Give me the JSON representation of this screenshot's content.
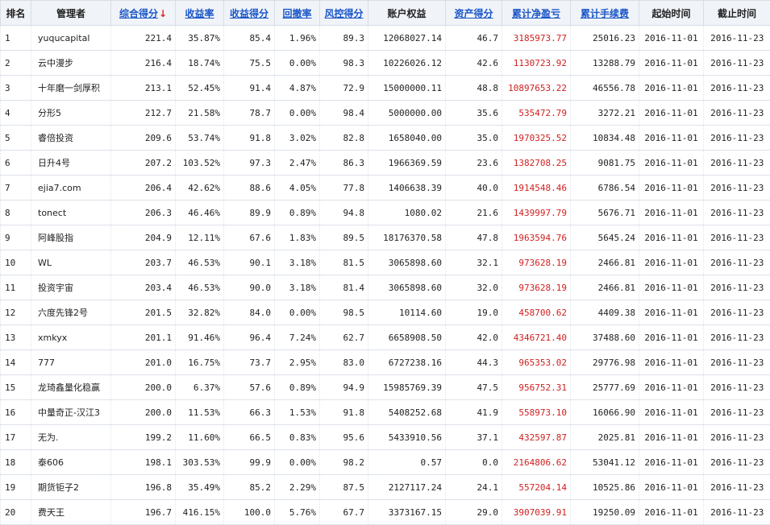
{
  "colors": {
    "link": "#1a56c8",
    "profit": "#d02020",
    "header_bg": "#f0f3f8",
    "sort_arrow": "#e02020"
  },
  "header": {
    "rank": "排名",
    "manager": "管理者",
    "score": "综合得分",
    "sort_arrow": "↓",
    "return_rate": "收益率",
    "return_score": "收益得分",
    "drawdown": "回撤率",
    "risk_score": "风控得分",
    "equity": "账户权益",
    "asset_score": "资产得分",
    "net_profit": "累计净盈亏",
    "fees": "累计手续费",
    "start": "起始时间",
    "end": "截止时间"
  },
  "rows": [
    {
      "rank": "1",
      "manager": "yuqucapital",
      "score": "221.4",
      "return_rate": "35.87%",
      "return_score": "85.4",
      "drawdown": "1.96%",
      "risk_score": "89.3",
      "equity": "12068027.14",
      "asset_score": "46.7",
      "net_profit": "3185973.77",
      "fees": "25016.23",
      "start": "2016-11-01",
      "end": "2016-11-23"
    },
    {
      "rank": "2",
      "manager": "云中漫步",
      "score": "216.4",
      "return_rate": "18.74%",
      "return_score": "75.5",
      "drawdown": "0.00%",
      "risk_score": "98.3",
      "equity": "10226026.12",
      "asset_score": "42.6",
      "net_profit": "1130723.92",
      "fees": "13288.79",
      "start": "2016-11-01",
      "end": "2016-11-23"
    },
    {
      "rank": "3",
      "manager": "十年磨一剑厚积",
      "score": "213.1",
      "return_rate": "52.45%",
      "return_score": "91.4",
      "drawdown": "4.87%",
      "risk_score": "72.9",
      "equity": "15000000.11",
      "asset_score": "48.8",
      "net_profit": "10897653.22",
      "fees": "46556.78",
      "start": "2016-11-01",
      "end": "2016-11-23"
    },
    {
      "rank": "4",
      "manager": "分形5",
      "score": "212.7",
      "return_rate": "21.58%",
      "return_score": "78.7",
      "drawdown": "0.00%",
      "risk_score": "98.4",
      "equity": "5000000.00",
      "asset_score": "35.6",
      "net_profit": "535472.79",
      "fees": "3272.21",
      "start": "2016-11-01",
      "end": "2016-11-23"
    },
    {
      "rank": "5",
      "manager": "睿倍投资",
      "score": "209.6",
      "return_rate": "53.74%",
      "return_score": "91.8",
      "drawdown": "3.02%",
      "risk_score": "82.8",
      "equity": "1658040.00",
      "asset_score": "35.0",
      "net_profit": "1970325.52",
      "fees": "10834.48",
      "start": "2016-11-01",
      "end": "2016-11-23"
    },
    {
      "rank": "6",
      "manager": "日升4号",
      "score": "207.2",
      "return_rate": "103.52%",
      "return_score": "97.3",
      "drawdown": "2.47%",
      "risk_score": "86.3",
      "equity": "1966369.59",
      "asset_score": "23.6",
      "net_profit": "1382708.25",
      "fees": "9081.75",
      "start": "2016-11-01",
      "end": "2016-11-23"
    },
    {
      "rank": "7",
      "manager": "ejia7.com",
      "score": "206.4",
      "return_rate": "42.62%",
      "return_score": "88.6",
      "drawdown": "4.05%",
      "risk_score": "77.8",
      "equity": "1406638.39",
      "asset_score": "40.0",
      "net_profit": "1914548.46",
      "fees": "6786.54",
      "start": "2016-11-01",
      "end": "2016-11-23"
    },
    {
      "rank": "8",
      "manager": "tonect",
      "score": "206.3",
      "return_rate": "46.46%",
      "return_score": "89.9",
      "drawdown": "0.89%",
      "risk_score": "94.8",
      "equity": "1080.02",
      "asset_score": "21.6",
      "net_profit": "1439997.79",
      "fees": "5676.71",
      "start": "2016-11-01",
      "end": "2016-11-23"
    },
    {
      "rank": "9",
      "manager": "阿峰股指",
      "score": "204.9",
      "return_rate": "12.11%",
      "return_score": "67.6",
      "drawdown": "1.83%",
      "risk_score": "89.5",
      "equity": "18176370.58",
      "asset_score": "47.8",
      "net_profit": "1963594.76",
      "fees": "5645.24",
      "start": "2016-11-01",
      "end": "2016-11-23"
    },
    {
      "rank": "10",
      "manager": "WL",
      "score": "203.7",
      "return_rate": "46.53%",
      "return_score": "90.1",
      "drawdown": "3.18%",
      "risk_score": "81.5",
      "equity": "3065898.60",
      "asset_score": "32.1",
      "net_profit": "973628.19",
      "fees": "2466.81",
      "start": "2016-11-01",
      "end": "2016-11-23"
    },
    {
      "rank": "11",
      "manager": "投资宇宙",
      "score": "203.4",
      "return_rate": "46.53%",
      "return_score": "90.0",
      "drawdown": "3.18%",
      "risk_score": "81.4",
      "equity": "3065898.60",
      "asset_score": "32.0",
      "net_profit": "973628.19",
      "fees": "2466.81",
      "start": "2016-11-01",
      "end": "2016-11-23"
    },
    {
      "rank": "12",
      "manager": "六度先锋2号",
      "score": "201.5",
      "return_rate": "32.82%",
      "return_score": "84.0",
      "drawdown": "0.00%",
      "risk_score": "98.5",
      "equity": "10114.60",
      "asset_score": "19.0",
      "net_profit": "458700.62",
      "fees": "4409.38",
      "start": "2016-11-01",
      "end": "2016-11-23"
    },
    {
      "rank": "13",
      "manager": "xmkyx",
      "score": "201.1",
      "return_rate": "91.46%",
      "return_score": "96.4",
      "drawdown": "7.24%",
      "risk_score": "62.7",
      "equity": "6658908.50",
      "asset_score": "42.0",
      "net_profit": "4346721.40",
      "fees": "37488.60",
      "start": "2016-11-01",
      "end": "2016-11-23"
    },
    {
      "rank": "14",
      "manager": "777",
      "score": "201.0",
      "return_rate": "16.75%",
      "return_score": "73.7",
      "drawdown": "2.95%",
      "risk_score": "83.0",
      "equity": "6727238.16",
      "asset_score": "44.3",
      "net_profit": "965353.02",
      "fees": "29776.98",
      "start": "2016-11-01",
      "end": "2016-11-23"
    },
    {
      "rank": "15",
      "manager": "龙琦鑫量化稳赢",
      "score": "200.0",
      "return_rate": "6.37%",
      "return_score": "57.6",
      "drawdown": "0.89%",
      "risk_score": "94.9",
      "equity": "15985769.39",
      "asset_score": "47.5",
      "net_profit": "956752.31",
      "fees": "25777.69",
      "start": "2016-11-01",
      "end": "2016-11-23"
    },
    {
      "rank": "16",
      "manager": "中量奇正-汉江3",
      "score": "200.0",
      "return_rate": "11.53%",
      "return_score": "66.3",
      "drawdown": "1.53%",
      "risk_score": "91.8",
      "equity": "5408252.68",
      "asset_score": "41.9",
      "net_profit": "558973.10",
      "fees": "16066.90",
      "start": "2016-11-01",
      "end": "2016-11-23"
    },
    {
      "rank": "17",
      "manager": "无为.",
      "score": "199.2",
      "return_rate": "11.60%",
      "return_score": "66.5",
      "drawdown": "0.83%",
      "risk_score": "95.6",
      "equity": "5433910.56",
      "asset_score": "37.1",
      "net_profit": "432597.87",
      "fees": "2025.81",
      "start": "2016-11-01",
      "end": "2016-11-23"
    },
    {
      "rank": "18",
      "manager": "泰606",
      "score": "198.1",
      "return_rate": "303.53%",
      "return_score": "99.9",
      "drawdown": "0.00%",
      "risk_score": "98.2",
      "equity": "0.57",
      "asset_score": "0.0",
      "net_profit": "2164806.62",
      "fees": "53041.12",
      "start": "2016-11-01",
      "end": "2016-11-23"
    },
    {
      "rank": "19",
      "manager": "期货钜子2",
      "score": "196.8",
      "return_rate": "35.49%",
      "return_score": "85.2",
      "drawdown": "2.29%",
      "risk_score": "87.5",
      "equity": "2127117.24",
      "asset_score": "24.1",
      "net_profit": "557204.14",
      "fees": "10525.86",
      "start": "2016-11-01",
      "end": "2016-11-23"
    },
    {
      "rank": "20",
      "manager": "费天王",
      "score": "196.7",
      "return_rate": "416.15%",
      "return_score": "100.0",
      "drawdown": "5.76%",
      "risk_score": "67.7",
      "equity": "3373167.15",
      "asset_score": "29.0",
      "net_profit": "3907039.91",
      "fees": "19250.09",
      "start": "2016-11-01",
      "end": "2016-11-23"
    }
  ]
}
